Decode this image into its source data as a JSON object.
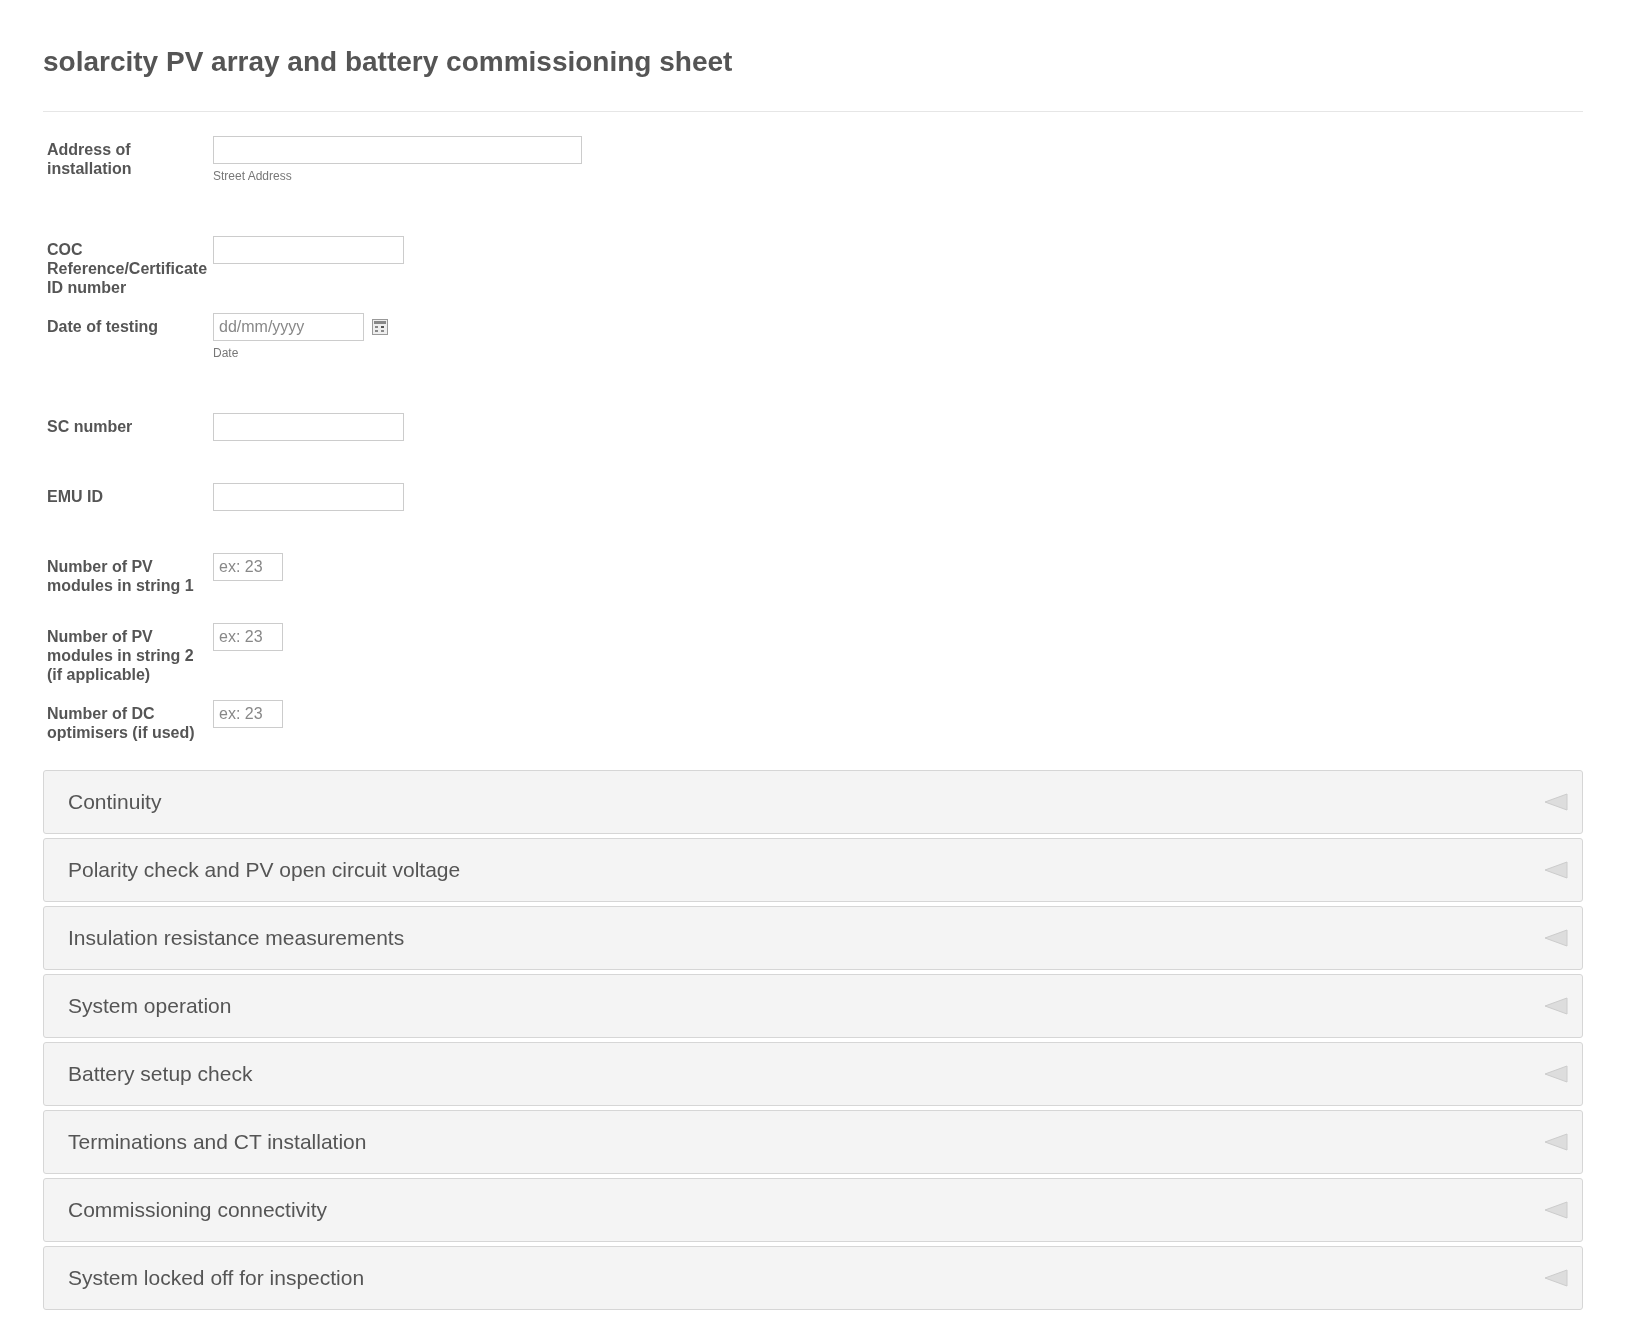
{
  "form": {
    "title": "solarcity PV array and battery commissioning sheet",
    "fields": [
      {
        "kind": "address",
        "label": "Address of installation",
        "sublabel": "Street Address"
      },
      {
        "kind": "text",
        "label": "COC Reference/Certificate ID number"
      },
      {
        "kind": "date",
        "label": "Date of testing",
        "placeholder": "dd/mm/yyyy",
        "sublabel": "Date"
      },
      {
        "kind": "text",
        "label": "SC number"
      },
      {
        "kind": "text",
        "label": "EMU ID"
      },
      {
        "kind": "number",
        "label": "Number of PV modules in string 1",
        "placeholder": "ex: 23"
      },
      {
        "kind": "number",
        "label": "Number of PV modules in string 2 (if applicable)",
        "placeholder": "ex: 23"
      },
      {
        "kind": "number",
        "label": "Number of DC optimisers (if used)",
        "placeholder": "ex: 23"
      }
    ],
    "sections": [
      {
        "title": "Continuity",
        "expanded": false
      },
      {
        "title": "Polarity check and PV open circuit voltage",
        "expanded": false
      },
      {
        "title": "Insulation resistance measurements",
        "expanded": false
      },
      {
        "title": "System operation",
        "expanded": false
      },
      {
        "title": "Battery setup check",
        "expanded": false
      },
      {
        "title": "Terminations and CT installation",
        "expanded": false
      },
      {
        "title": "Commissioning connectivity",
        "expanded": false
      },
      {
        "title": "System locked off for inspection",
        "expanded": false
      }
    ]
  }
}
